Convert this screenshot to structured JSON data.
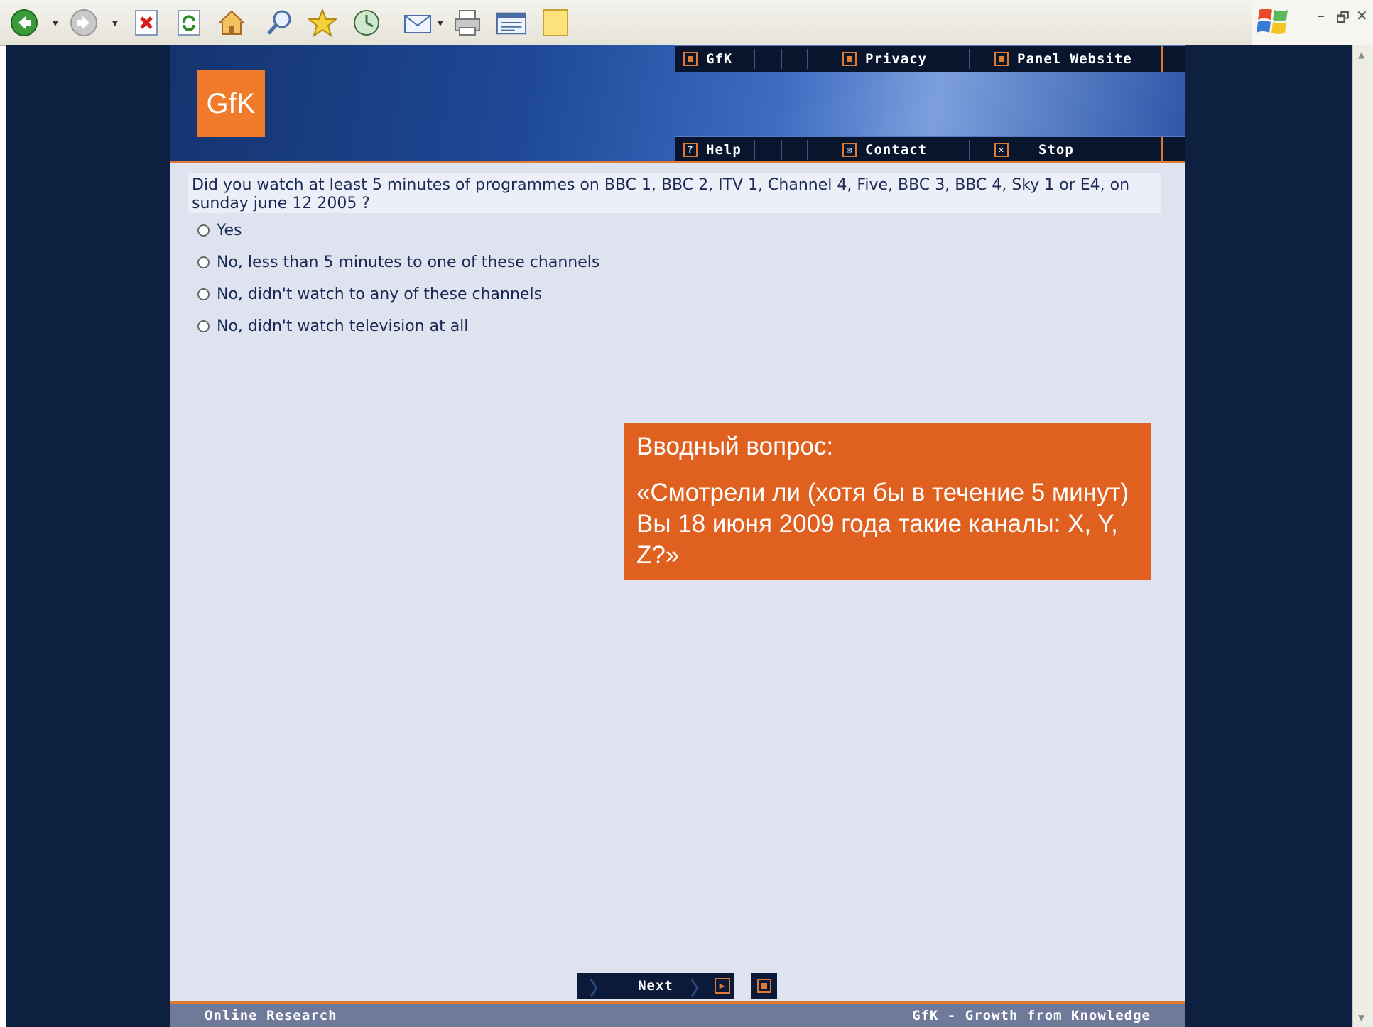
{
  "browser": {
    "toolbar_icons": [
      "back-icon",
      "forward-icon",
      "stop-icon",
      "refresh-icon",
      "home-icon",
      "search-icon",
      "favorites-icon",
      "history-icon",
      "mail-icon",
      "print-icon",
      "edit-icon",
      "notes-icon"
    ],
    "window_controls": {
      "minimize": "–",
      "restore": "🗗",
      "close": "✕"
    }
  },
  "header": {
    "logo": "GfK",
    "top_nav": [
      {
        "label": "GfK",
        "icon": "square-icon"
      },
      {
        "label": "Privacy",
        "icon": "square-icon"
      },
      {
        "label": "Panel Website",
        "icon": "square-icon"
      }
    ],
    "bottom_nav": [
      {
        "label": "Help",
        "icon": "help-icon",
        "glyph": "?"
      },
      {
        "label": "Contact",
        "icon": "envelope-icon",
        "glyph": "✉"
      },
      {
        "label": "Stop",
        "icon": "close-icon",
        "glyph": "✕"
      }
    ]
  },
  "question": {
    "text": "Did you watch at least 5 minutes of programmes on BBC 1, BBC 2, ITV 1, Channel 4, Five, BBC 3, BBC 4, Sky 1 or E4, on sunday june 12 2005 ?",
    "options": [
      "Yes",
      "No, less than 5 minutes to one of these channels",
      "No, didn't watch to any of these channels",
      "No, didn't watch television at all"
    ]
  },
  "callout": {
    "title": "Вводный вопрос:",
    "body": "«Смотрели ли (хотя бы в течение 5 минут) Вы 18 июня 2009 года такие каналы: X, Y, Z?»"
  },
  "buttons": {
    "next": "Next"
  },
  "footer": {
    "left": "Online Research",
    "right": "GfK - Growth from Knowledge"
  },
  "colors": {
    "brand_orange": "#e07a30",
    "navy": "#0d2040",
    "content_bg": "#dfe3ef",
    "callout_bg": "#e06020"
  }
}
